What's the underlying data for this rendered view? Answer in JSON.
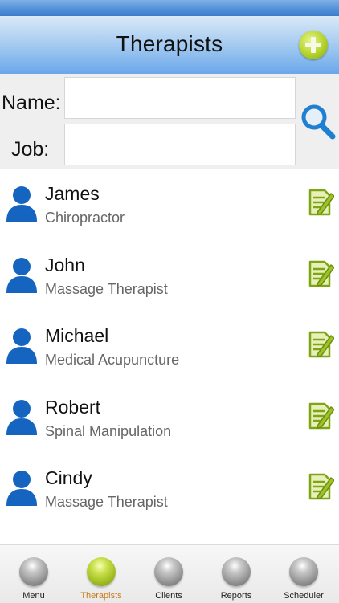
{
  "header": {
    "title": "Therapists",
    "add_icon": "plus-circle-icon"
  },
  "search": {
    "name_label": "Name:",
    "job_label": "Job:",
    "name_value": "",
    "job_value": "",
    "search_icon": "magnifier-icon"
  },
  "therapists": [
    {
      "name": "James",
      "job": "Chiropractor"
    },
    {
      "name": "John",
      "job": "Massage Therapist"
    },
    {
      "name": "Michael",
      "job": "Medical Acupuncture"
    },
    {
      "name": "Robert",
      "job": "Spinal Manipulation"
    },
    {
      "name": "Cindy",
      "job": "Massage Therapist"
    }
  ],
  "tabs": [
    {
      "label": "Menu",
      "active": false
    },
    {
      "label": "Therapists",
      "active": true
    },
    {
      "label": "Clients",
      "active": false
    },
    {
      "label": "Reports",
      "active": false
    },
    {
      "label": "Scheduler",
      "active": false
    }
  ],
  "colors": {
    "header_blue": "#6aa8ea",
    "accent_green": "#8fb51a",
    "avatar_blue": "#1565c0",
    "active_tab_label": "#c87a1a"
  }
}
